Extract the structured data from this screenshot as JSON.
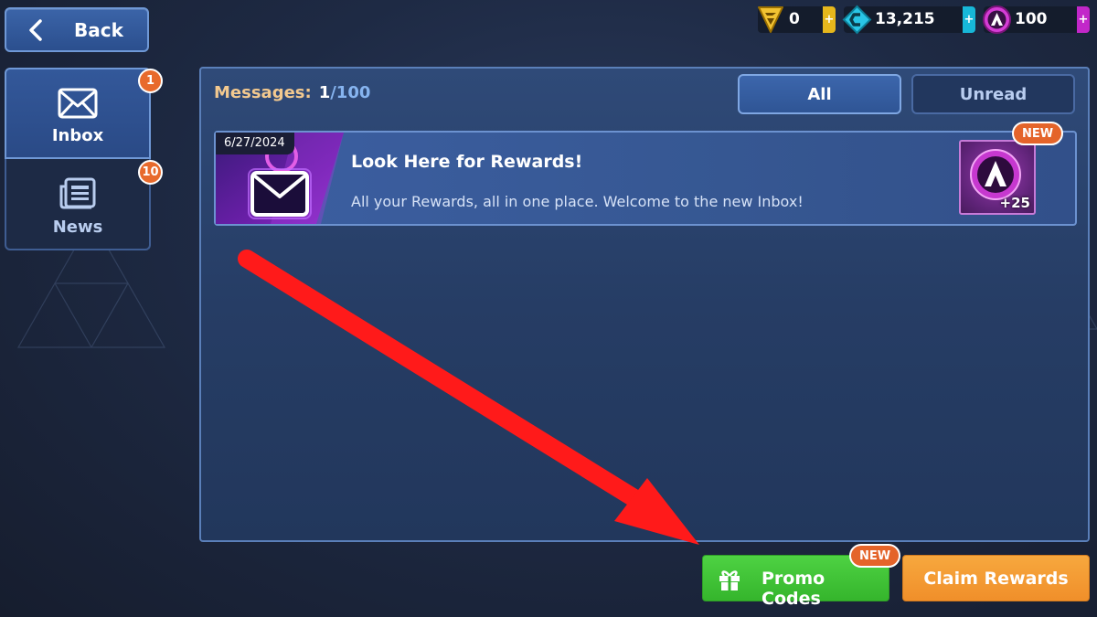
{
  "header": {
    "back_label": "Back"
  },
  "currencies": [
    {
      "name": "tokens",
      "value": "0",
      "icon": "chevron-token-icon",
      "color": "#f1c232",
      "plus_color": "#e6b71c"
    },
    {
      "name": "credits",
      "value": "13,215",
      "icon": "credits-icon",
      "color": "#29c6e6",
      "plus_color": "#17b7d8"
    },
    {
      "name": "premium",
      "value": "100",
      "icon": "premium-a-icon",
      "color": "#d53cd5",
      "plus_color": "#c227c9"
    }
  ],
  "sidebar": {
    "tabs": [
      {
        "label": "Inbox",
        "icon": "envelope-icon",
        "badge": "1",
        "selected": true
      },
      {
        "label": "News",
        "icon": "newspaper-icon",
        "badge": "10",
        "selected": false
      }
    ]
  },
  "panel": {
    "messages_label": "Messages:",
    "messages_count": "1",
    "messages_total": "/100",
    "filters": {
      "all": "All",
      "unread": "Unread",
      "selected": "All"
    },
    "messages": [
      {
        "date": "6/27/2024",
        "title": "Look Here for Rewards!",
        "body": "All your Rewards, all in one place. Welcome to the new Inbox!",
        "badge": "NEW",
        "reward_icon": "premium-a-icon",
        "reward_qty": "+25"
      }
    ]
  },
  "footer": {
    "promo_label": "Promo Codes",
    "promo_badge": "NEW",
    "claim_label": "Claim Rewards"
  },
  "overlay": {
    "annotation": "red-arrow-icon",
    "color": "#ff1a1a"
  }
}
